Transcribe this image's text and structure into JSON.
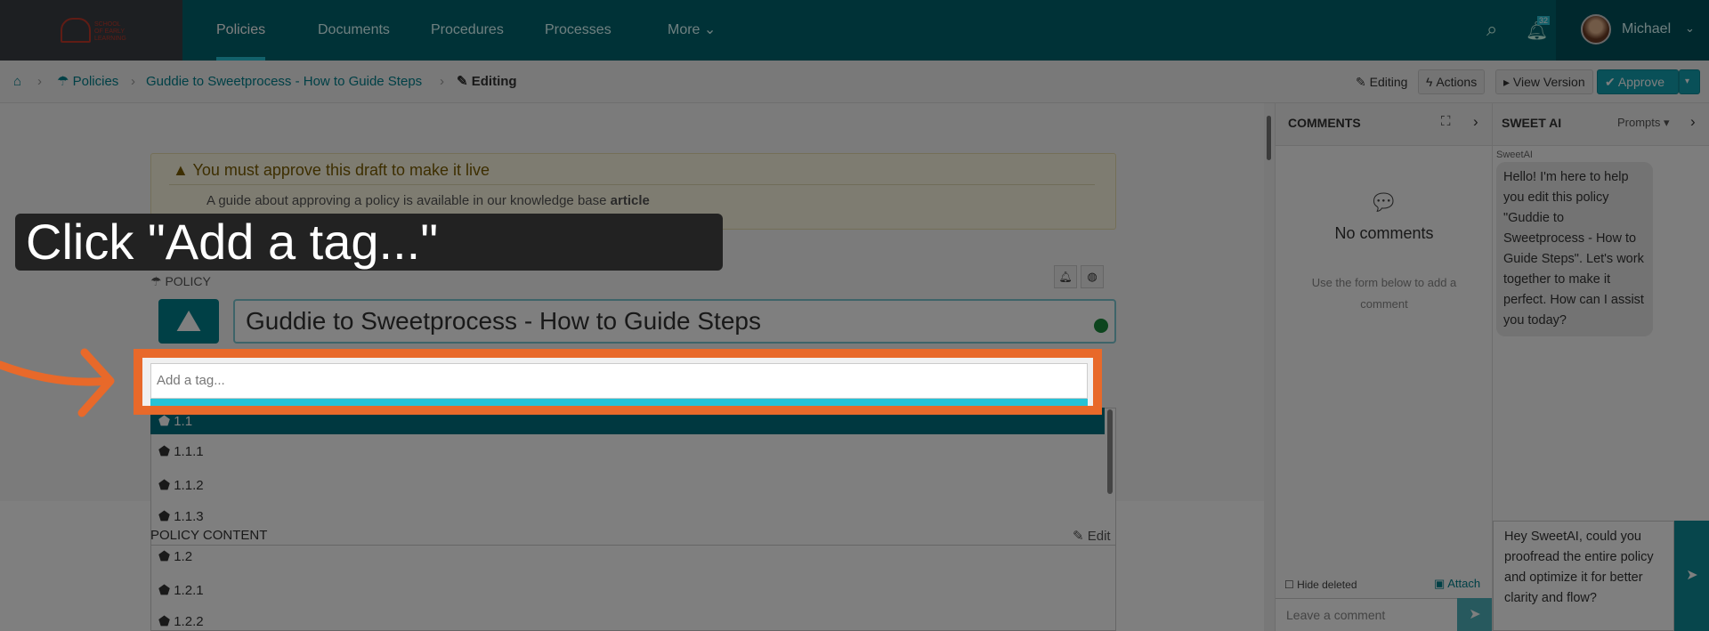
{
  "nav": {
    "logo_text": "SCHOOL OF EARLY LEARNING",
    "items": [
      "Policies",
      "Documents",
      "Procedures",
      "Processes",
      "More"
    ],
    "notification_count": "32",
    "user": "Michael"
  },
  "breadcrumb": {
    "items": [
      "Policies",
      "Guddie to Sweetprocess - How to Guide Steps"
    ],
    "current": "Editing"
  },
  "toolbar": {
    "editing": "Editing",
    "actions": "Actions",
    "view_version": "View Version",
    "approve": "Approve"
  },
  "alert": {
    "title": "You must approve this draft to make it live",
    "body": "A guide about approving a policy is available in our knowledge base",
    "link": "article"
  },
  "policy": {
    "label": "POLICY",
    "title": "Guddie to Sweetprocess - How to Guide Steps",
    "tag_placeholder": "Add a tag...",
    "tags": [
      "1.1",
      "1.1.1",
      "1.1.2",
      "1.1.3",
      "1.2",
      "1.2.1",
      "1.2.2"
    ],
    "content_label": "POLICY CONTENT",
    "edit": "Edit"
  },
  "comments": {
    "title": "COMMENTS",
    "empty_title": "No comments",
    "empty_hint": "Use the form below to add a comment",
    "hide_deleted": "Hide deleted",
    "attach": "Attach",
    "placeholder": "Leave a comment"
  },
  "sweetai": {
    "title": "SWEET AI",
    "prompts": "Prompts",
    "sender": "SweetAI",
    "message": "Hello! I'm here to help you edit this policy \"Guddie to Sweetprocess - How to Guide Steps\". Let's work together to make it perfect. How can I assist you today?",
    "input": "Hey SweetAI, could you proofread the entire policy and optimize it for better clarity and flow?"
  },
  "tutorial": {
    "instruction": "Click \"Add a tag...\""
  }
}
